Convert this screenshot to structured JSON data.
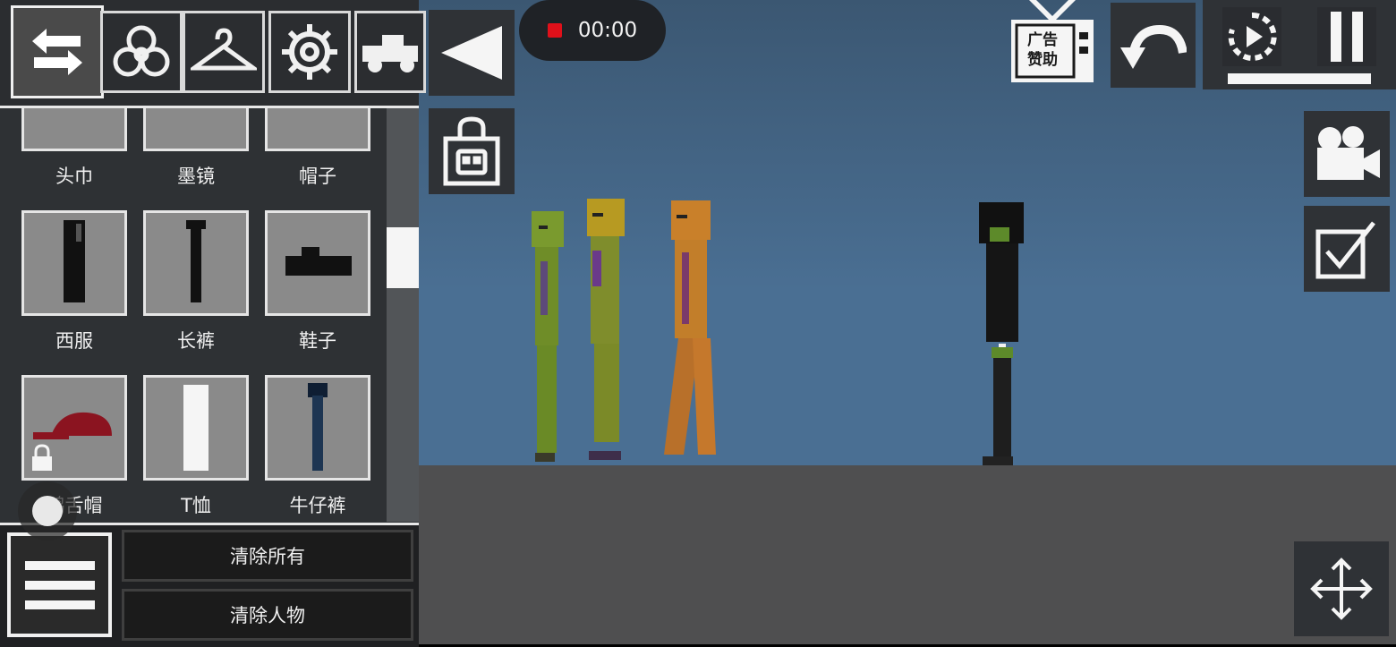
{
  "panel": {
    "items": [
      {
        "label": "头巾"
      },
      {
        "label": "墨镜"
      },
      {
        "label": "帽子"
      },
      {
        "label": "西服"
      },
      {
        "label": "长裤"
      },
      {
        "label": "鞋子"
      },
      {
        "label": "鸭舌帽"
      },
      {
        "label": "T恤"
      },
      {
        "label": "牛仔裤"
      }
    ],
    "clear_all": "清除所有",
    "clear_people": "清除人物"
  },
  "recorder": {
    "time": "00:00"
  },
  "ad": {
    "line1": "广告",
    "line2": "赞助"
  },
  "colors": {
    "sky": "#4a6f93",
    "ground": "#4f4f50",
    "record": "#e0101a"
  }
}
